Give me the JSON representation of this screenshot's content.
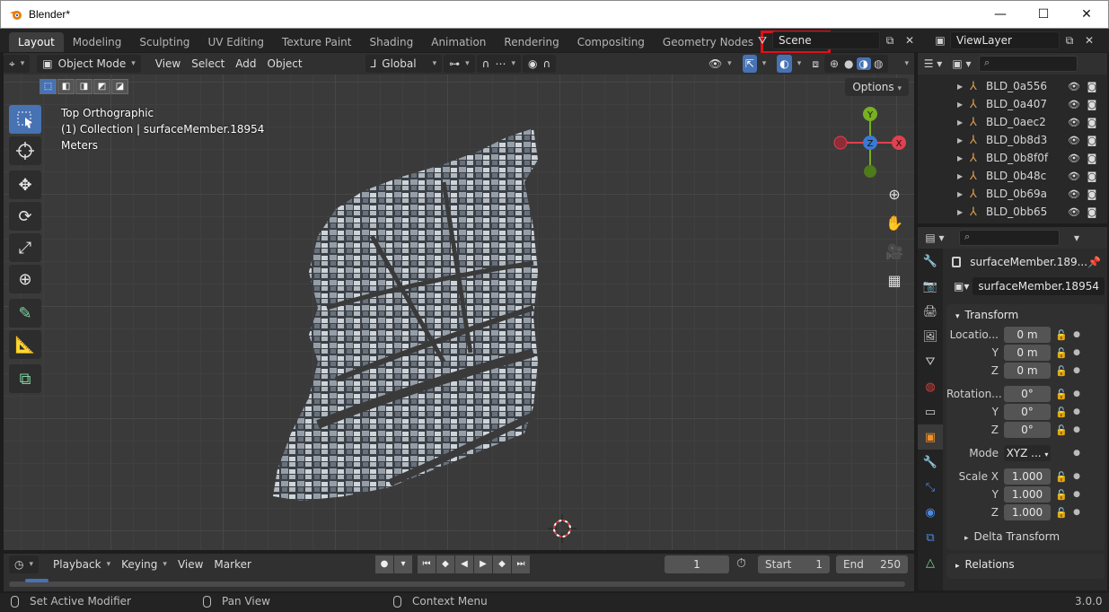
{
  "window": {
    "title": "Blender*",
    "minimize": "—",
    "maximize": "☐",
    "close": "✕"
  },
  "workspaces": [
    {
      "label": "Layout"
    },
    {
      "label": "Modeling"
    },
    {
      "label": "Sculpting"
    },
    {
      "label": "UV Editing"
    },
    {
      "label": "Texture Paint"
    },
    {
      "label": "Shading"
    },
    {
      "label": "Animation"
    },
    {
      "label": "Rendering"
    },
    {
      "label": "Compositing"
    },
    {
      "label": "Geometry Nodes"
    },
    {
      "label": "Scripting"
    }
  ],
  "workspace_add": "+",
  "scene": {
    "name": "Scene"
  },
  "view_layer": {
    "name": "ViewLayer"
  },
  "viewport_header": {
    "mode": "Object Mode",
    "menus": [
      "View",
      "Select",
      "Add",
      "Object"
    ],
    "transform_orientation": "Global"
  },
  "viewport": {
    "options_label": "Options",
    "view_name": "Top Orthographic",
    "collection_info": "(1) Collection | surfaceMember.18954",
    "units": "Meters",
    "gizmo": {
      "x": "X",
      "y": "Y",
      "z": "Z"
    }
  },
  "outliner": {
    "items": [
      {
        "name": "BLD_0a556"
      },
      {
        "name": "BLD_0a407"
      },
      {
        "name": "BLD_0aec2"
      },
      {
        "name": "BLD_0b8d3"
      },
      {
        "name": "BLD_0b8f0f"
      },
      {
        "name": "BLD_0b48c"
      },
      {
        "name": "BLD_0b69a"
      },
      {
        "name": "BLD_0bb65"
      }
    ]
  },
  "properties": {
    "object_title": "surfaceMember.189...",
    "object_name": "surfaceMember.18954",
    "transform": {
      "header": "Transform",
      "location_label": "Locatio...",
      "location": [
        "0 m",
        "0 m",
        "0 m"
      ],
      "rotation_label": "Rotation...",
      "rotation": [
        "0°",
        "0°",
        "0°"
      ],
      "mode_label": "Mode",
      "mode_value": "XYZ ...",
      "scale_label": "Scale X",
      "scale": [
        "1.000",
        "1.000",
        "1.000"
      ],
      "axis_y": "Y",
      "axis_z": "Z"
    },
    "delta_transform": "Delta Transform",
    "relations": "Relations"
  },
  "timeline": {
    "menus": [
      "Playback",
      "Keying",
      "View",
      "Marker"
    ],
    "current_frame": "1",
    "start_label": "Start",
    "start_value": "1",
    "end_label": "End",
    "end_value": "250"
  },
  "statusbar": {
    "left": "Set Active Modifier",
    "middle": "Pan View",
    "right": "Context Menu",
    "version": "3.0.0"
  },
  "colors": {
    "accent": "#4772b3",
    "highlight_box": "#e0101a",
    "axis_x": "#e0404f",
    "axis_y": "#77b022",
    "axis_z": "#3a7ad4"
  }
}
